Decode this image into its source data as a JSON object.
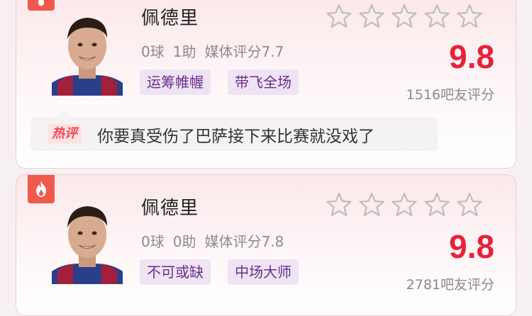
{
  "cards": [
    {
      "name": "佩德里",
      "goals": "0球",
      "assists": "1助",
      "media_rating": "媒体评分7.7",
      "tags": [
        "运筹帷幄",
        "带飞全场"
      ],
      "score": "9.8",
      "rater_count": "1516吧友评分",
      "hot_label": "热评",
      "hot_comment": "你要真受伤了巴萨接下来比赛就没戏了"
    },
    {
      "name": "佩德里",
      "goals": "0球",
      "assists": "0助",
      "media_rating": "媒体评分7.8",
      "tags": [
        "不可或缺",
        "中场大师"
      ],
      "score": "9.8",
      "rater_count": "2781吧友评分"
    }
  ],
  "colors": {
    "accent_red": "#e8223a",
    "tag_bg": "#efe4f4",
    "tag_text": "#6a2e8a",
    "badge_red": "#ef5a4c"
  },
  "icons": {
    "badge": "flame-icon",
    "rating": "star-outline-icon"
  }
}
